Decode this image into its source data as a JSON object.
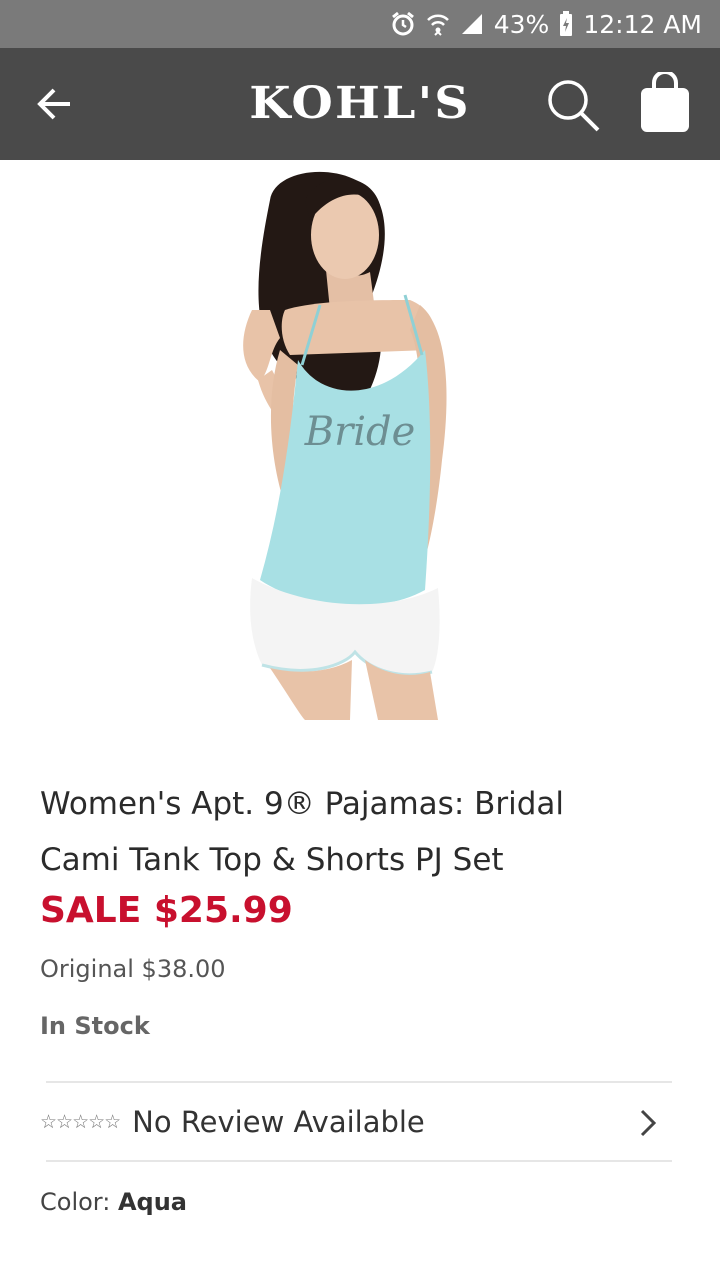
{
  "status_bar": {
    "battery": "43%",
    "time": "12:12 AM",
    "icons": [
      "alarm-icon",
      "wifi-icon",
      "signal-icon",
      "battery-icon"
    ]
  },
  "app_bar": {
    "logo": "KOHL'S",
    "icons": [
      "back-arrow-icon",
      "search-icon",
      "shopping-bag-icon"
    ]
  },
  "product": {
    "image_text": "Bride",
    "title_line1": "Women's Apt. 9® Pajamas: Bridal",
    "title_line2": "Cami Tank Top & Shorts PJ Set",
    "sale_price": "SALE $25.99",
    "original_price": "Original $38.00",
    "stock": "In Stock",
    "reviews": {
      "stars": "☆☆☆☆☆",
      "text": "No Review Available"
    },
    "color": {
      "label": "Color:",
      "value": "Aqua"
    }
  },
  "colors": {
    "status_bar": "#7a7a7a",
    "app_bar": "#4a4a4a",
    "sale": "#c8102e",
    "top": "#a8e0e4"
  }
}
